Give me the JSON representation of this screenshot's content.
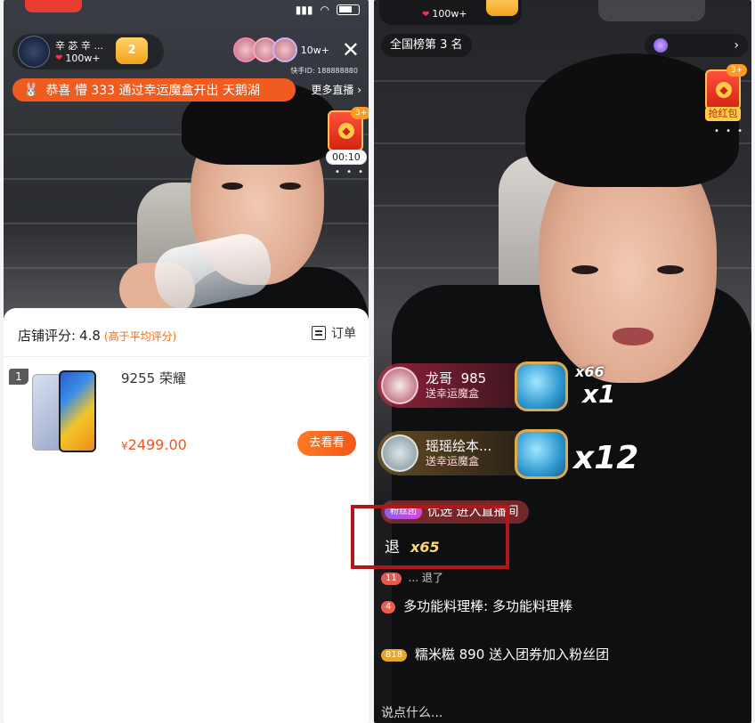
{
  "left": {
    "anchor": {
      "name": "辛 苾 辛 ...",
      "likes": "100w+",
      "level": "2"
    },
    "viewers": {
      "count": "10w+"
    },
    "host_id": "快手ID: 188888880",
    "ticker": {
      "icon": "🐰",
      "text": "恭喜 懵 333 通过幸运魔盒开出 天鹅湖"
    },
    "more_live": "更多直播 ›",
    "red_packet": {
      "count": "3+",
      "timer": "00:10"
    },
    "shop": {
      "rating_label": "店铺评分:",
      "rating_value": "4.8",
      "rating_hint": "(高于平均评分)",
      "order_label": "订单",
      "product": {
        "index": "1",
        "title": "9255 荣耀",
        "price_symbol": "¥",
        "price": "2499.00",
        "button": "去看看"
      }
    }
  },
  "right": {
    "top_likes": "100w+",
    "rank": "全国榜第 3 名",
    "red_packet": {
      "count": "3+",
      "label": "抢红包"
    },
    "gifts": [
      {
        "user": "龙哥",
        "value": "985",
        "action": "送幸运魔盒",
        "combo_small": "x66",
        "combo": "x1"
      },
      {
        "user": "瑶瑶绘本...",
        "action": "送幸运魔盒",
        "combo": "x12"
      }
    ],
    "enter": {
      "tag": "粉丝团",
      "text": "优选 进入直播间"
    },
    "highlight": {
      "text": "退",
      "combo": "x65"
    },
    "chat": [
      {
        "level": "11",
        "text": "... 退了"
      },
      {
        "level": "4",
        "user": "多功能料理棒:",
        "text": "多功能料理棒"
      },
      {
        "level": "818",
        "user": "糯米糍 890",
        "text": "送入团券加入粉丝团"
      }
    ],
    "input_placeholder": "说点什么..."
  }
}
